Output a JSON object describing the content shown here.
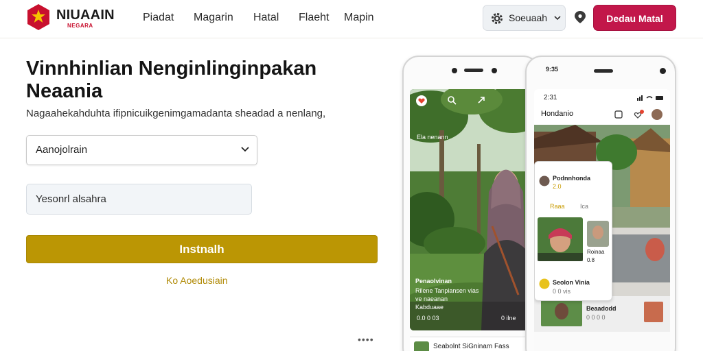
{
  "header": {
    "brand": "NIUAAIN",
    "brand_sub": "NEGARA",
    "nav": [
      "Piadat",
      "Magarin",
      "Hatal",
      "Flaeht",
      "Mapin"
    ],
    "language_label": "Soeuaah",
    "cta_label": "Dedau Matal"
  },
  "form": {
    "title": "Vinnhinlian Nenginlinginpakan Neaania",
    "subtitle": "Nagaahekahduhta ifipnicuikgenimgamadanta sheadad a nenlang,",
    "select_value": "Aanojolrain",
    "input_value": "Yesonrl alsahra",
    "submit_label": "Instnalh",
    "link_label": "Ko Aoedusiain",
    "pager_dots": "••••"
  },
  "phone_left": {
    "caption_title": "Penaolvinan",
    "caption_line1": "Rilene Tanpiansen vias",
    "caption_line2": "ve naeanan",
    "caption_line3": "Kabduaae",
    "meta_left": "0.0 0 03",
    "meta_right": "0 ilne",
    "tag": "Ela nenann",
    "bottom_label": "Seabolnt SiGninam Fass"
  },
  "phone_right": {
    "status_time": "2:31",
    "top_status": "9:35",
    "app_title": "Hondanio",
    "card_name": "Podnnhonda",
    "card_meta": "2.0",
    "tab_one": "Raaa",
    "tab_two": "Ica",
    "thumb_caption": "Roinaa",
    "thumb_meta": "0.8",
    "row_title": "Seolon Vinia",
    "row_meta": "0 0 vis",
    "row2_title": "Beaadodd",
    "row2_meta": "0 0 0 0"
  },
  "colors": {
    "brand_red": "#c8102e",
    "cta_crimson": "#c2174a",
    "submit_gold": "#bb9604",
    "link_gold": "#b08a05"
  }
}
